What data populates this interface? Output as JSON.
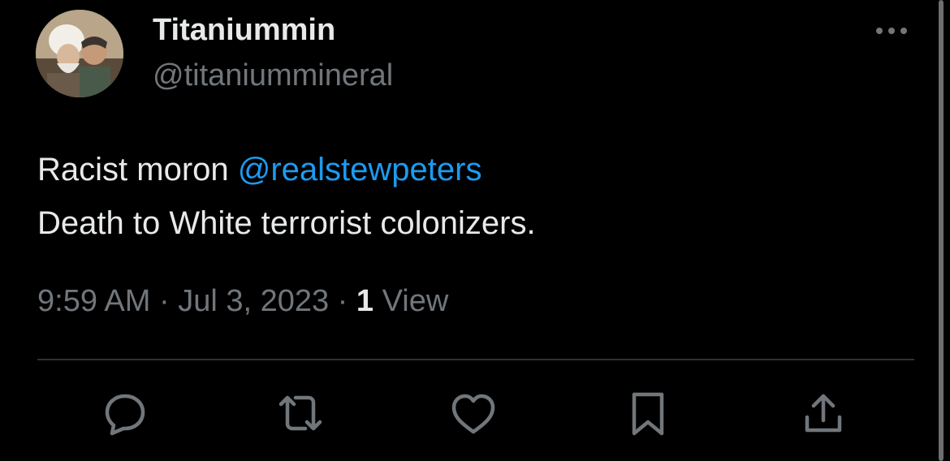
{
  "author": {
    "display_name": "Titaniummin",
    "handle": "@titaniummineral"
  },
  "tweet": {
    "text_prefix": "Racist moron ",
    "mention": "@realstewpeters",
    "line2": "Death to White terrorist colonizers."
  },
  "meta": {
    "time": "9:59 AM",
    "sep1": " · ",
    "date": "Jul 3, 2023",
    "sep2": " · ",
    "views_count": "1",
    "views_label": " View"
  },
  "actions": [
    {
      "name": "reply",
      "icon": "speech-bubble-icon"
    },
    {
      "name": "retweet",
      "icon": "retweet-arrows-icon"
    },
    {
      "name": "like",
      "icon": "heart-icon"
    },
    {
      "name": "bookmark",
      "icon": "bookmark-icon"
    },
    {
      "name": "share",
      "icon": "share-upload-icon"
    }
  ],
  "colors": {
    "background": "#000000",
    "text": "#e7e9ea",
    "secondary": "#71767b",
    "link": "#1d9bf0",
    "divider": "#2f3336"
  }
}
